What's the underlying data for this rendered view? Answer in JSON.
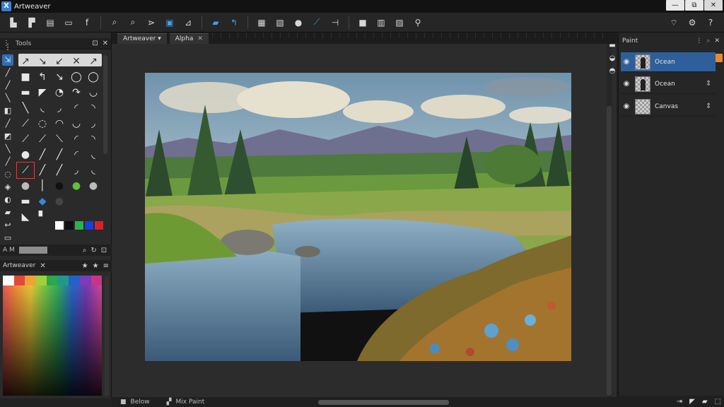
{
  "titlebar": {
    "title": "Artweaver",
    "logo": "X",
    "minimize": "—",
    "restore": "⧉",
    "close": "✕"
  },
  "toolbar": {
    "icons": [
      "new-file-icon",
      "open-file-icon",
      "save-icon",
      "print-icon",
      "font-icon",
      "zoom-in-icon",
      "zoom-out-icon",
      "hand-icon",
      "text-icon",
      "select-icon",
      "undo-icon",
      "redo-icon",
      "layer-icon",
      "mask-icon",
      "color-icon",
      "brush-icon",
      "transform-icon",
      "filter-icon",
      "frame-icon",
      "script-icon",
      "plugin-icon"
    ],
    "right_icons": [
      "wifi-icon",
      "settings-icon",
      "help-icon"
    ]
  },
  "tools_panel": {
    "title": "Tools",
    "close": "✕",
    "pin": "⊡"
  },
  "navigator": {
    "title": "A M"
  },
  "palette_panel": {
    "title": "Artweaver",
    "close": "✕",
    "star1": "★",
    "star2": "★",
    "menu": "≡"
  },
  "document": {
    "tabs": [
      {
        "label": "Artweaver ▾",
        "close": ""
      },
      {
        "label": "Alpha",
        "close": "✕"
      }
    ],
    "bottom": [
      {
        "icon": "■",
        "label": "Below"
      },
      {
        "icon": "▞",
        "label": "Mix Paint"
      }
    ]
  },
  "layers_panel": {
    "title": "Paint",
    "layers": [
      {
        "name": "Ocean",
        "active": true
      },
      {
        "name": "Ocean",
        "active": false
      },
      {
        "name": "Canvas",
        "active": false
      }
    ]
  },
  "colors": {
    "swatches": [
      "#ffffff",
      "#111111",
      "#2bb24a",
      "#1b3fd6",
      "#d3232d"
    ]
  }
}
